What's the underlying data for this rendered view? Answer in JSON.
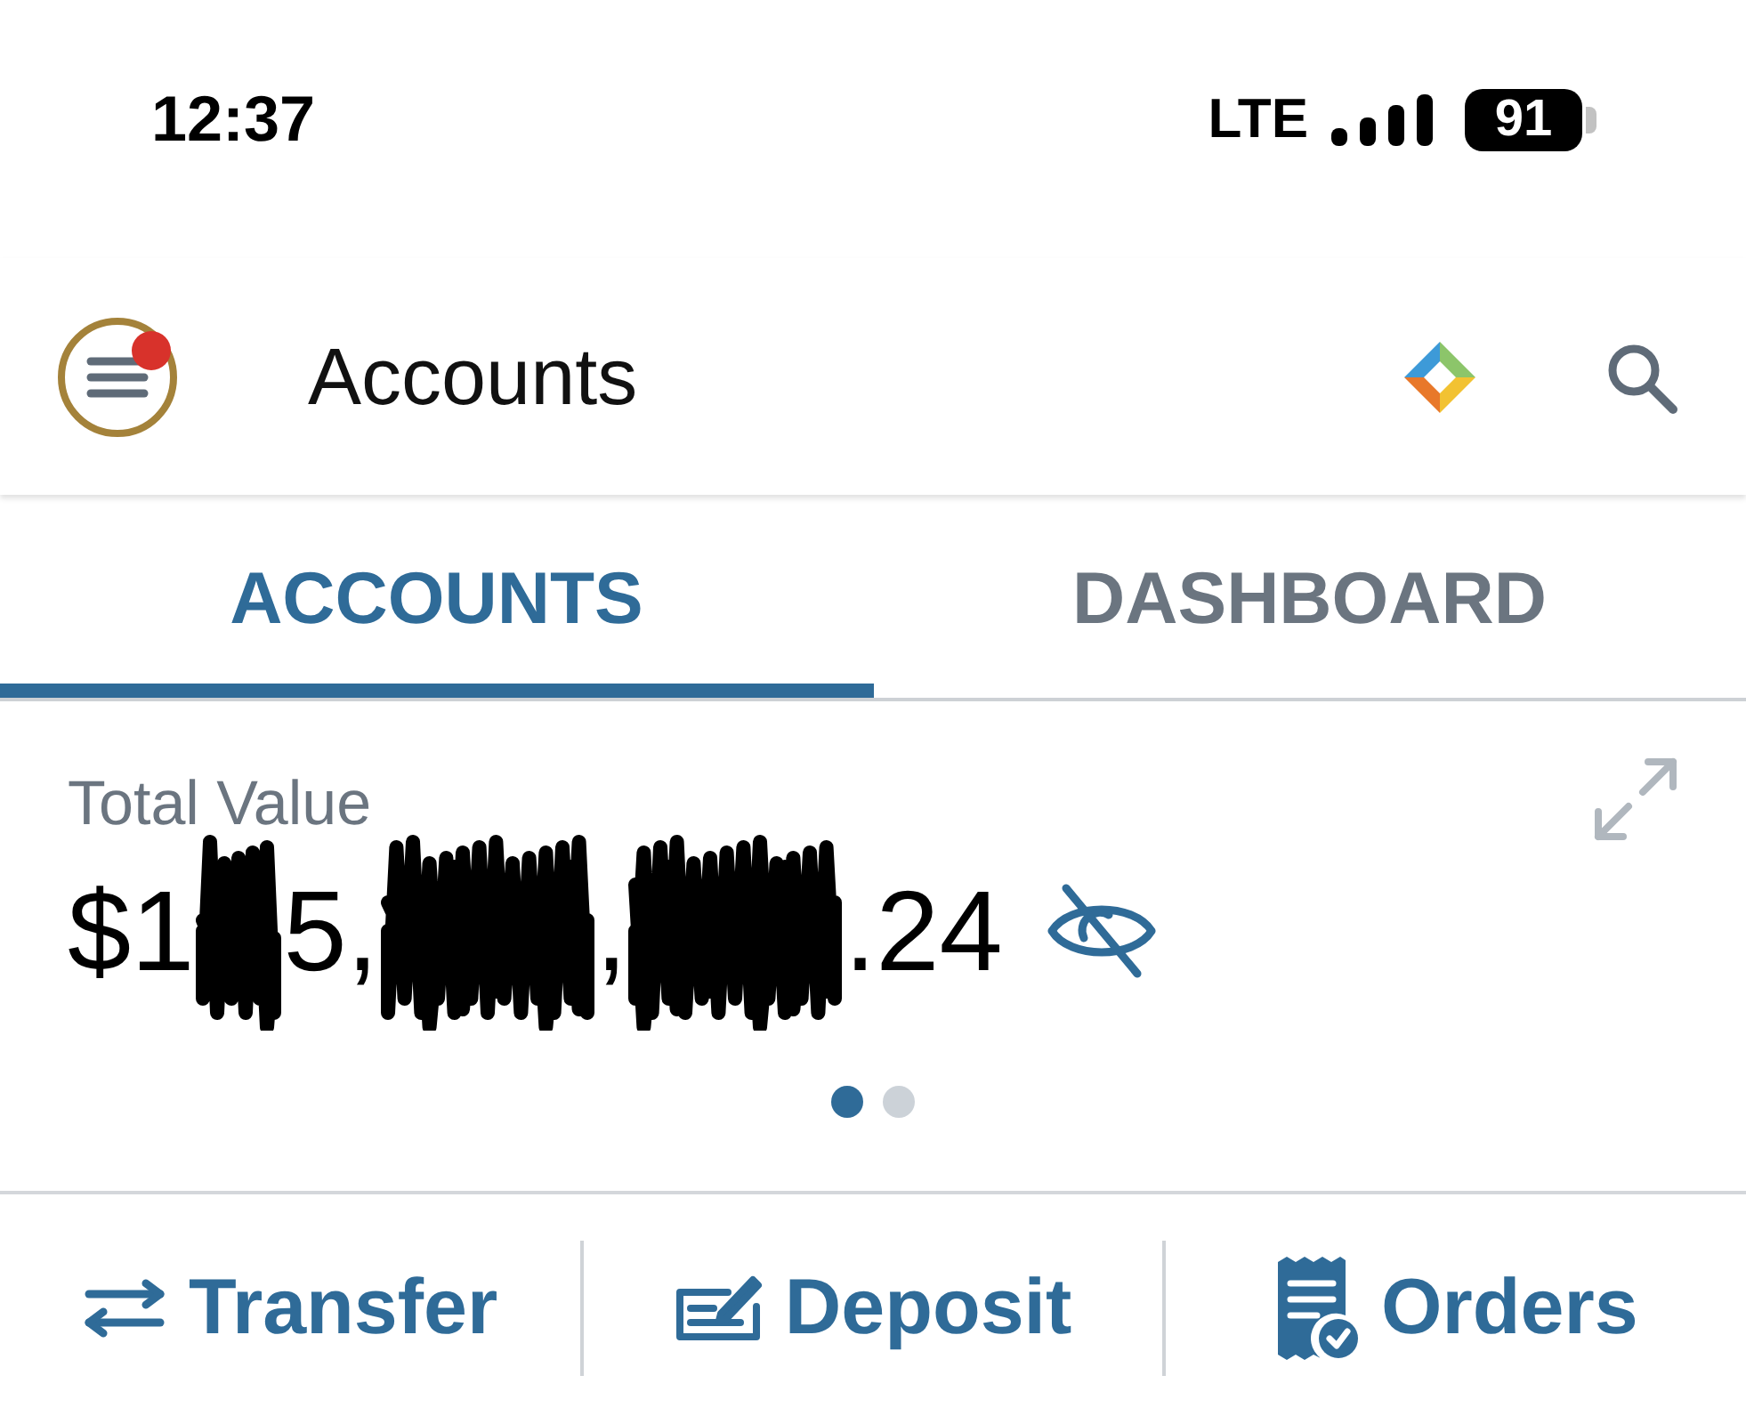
{
  "status_bar": {
    "time": "12:37",
    "network": "LTE",
    "battery": "91"
  },
  "header": {
    "title": "Accounts",
    "notification_dot": true
  },
  "tabs": [
    {
      "label": "ACCOUNTS",
      "selected": true
    },
    {
      "label": "DASHBOARD",
      "selected": false
    }
  ],
  "summary": {
    "label": "Total Value",
    "value_parts": [
      {
        "kind": "text",
        "text": "$1"
      },
      {
        "kind": "redacted"
      },
      {
        "kind": "text",
        "text": "5,"
      },
      {
        "kind": "redacted"
      },
      {
        "kind": "text",
        "text": ","
      },
      {
        "kind": "redacted"
      },
      {
        "kind": "text",
        "text": ".24"
      }
    ],
    "pages": [
      {
        "selected": true
      },
      {
        "selected": false
      }
    ]
  },
  "actions": [
    {
      "kind": "transfer",
      "label": "Transfer"
    },
    {
      "kind": "deposit",
      "label": "Deposit"
    },
    {
      "kind": "orders",
      "label": "Orders"
    }
  ]
}
